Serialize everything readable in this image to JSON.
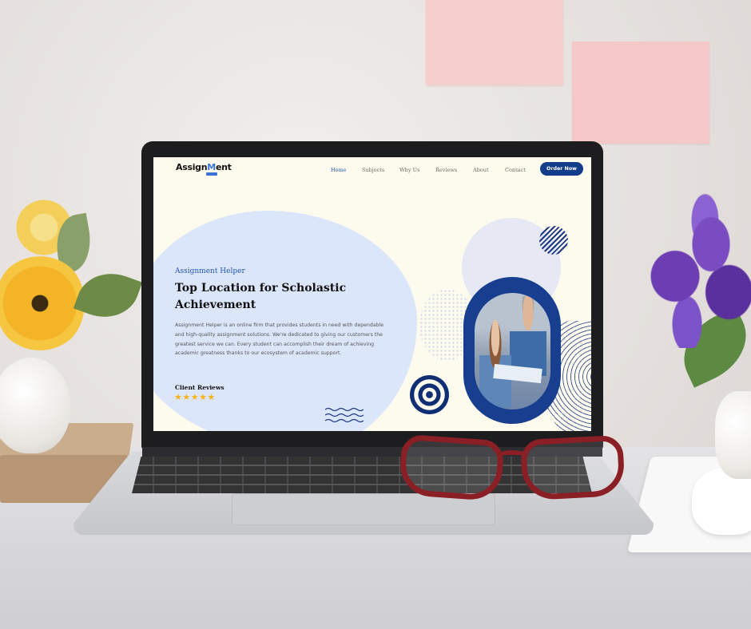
{
  "website": {
    "logo": {
      "text_a": "Assign",
      "text_b": "M",
      "text_c": "ent"
    },
    "nav": {
      "items": [
        {
          "label": "Home",
          "active": true
        },
        {
          "label": "Subjects",
          "active": false
        },
        {
          "label": "Why Us",
          "active": false
        },
        {
          "label": "Reviews",
          "active": false
        },
        {
          "label": "About",
          "active": false
        },
        {
          "label": "Contact",
          "active": false
        }
      ],
      "cta_label": "Order Now"
    },
    "hero": {
      "eyebrow": "Assignment Helper",
      "title": "Top Location for Scholastic Achievement",
      "body": "Assignment Helper is an online firm that provides students in need with dependable and high-quality assignment solutions. We're dedicated to giving our customers the greatest service we can. Every student can accomplish their dream of achieving academic greatness thanks to our ecosystem of academic support.",
      "reviews_label": "Client Reviews",
      "stars": "★★★★★",
      "rating": 5
    },
    "colors": {
      "background": "#fdfbee",
      "accent": "#123d8a",
      "link": "#2457b5",
      "blob": "#dce6fb",
      "stars": "#f5b21b"
    }
  },
  "scene": {
    "objects": [
      "laptop",
      "red-eyeglasses",
      "sunflower-vase",
      "purple-orchid-vase",
      "sticky-notes",
      "mouse",
      "books"
    ]
  }
}
